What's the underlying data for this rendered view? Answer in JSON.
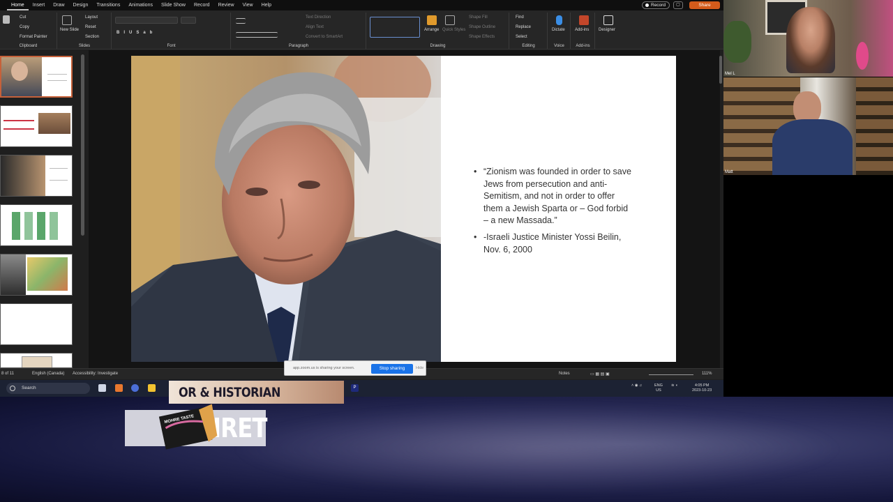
{
  "ppt": {
    "tabs": [
      "Home",
      "Insert",
      "Draw",
      "Design",
      "Transitions",
      "Animations",
      "Slide Show",
      "Record",
      "Review",
      "View",
      "Help"
    ],
    "record_label": "Record",
    "share_label": "Share",
    "comment_icon": "comment-icon",
    "ribbon": {
      "clipboard": {
        "cut": "Cut",
        "copy": "Copy",
        "format_painter": "Format Painter",
        "label": "Clipboard"
      },
      "slides": {
        "new_slide": "New Slide",
        "layout": "Layout",
        "reset": "Reset",
        "section": "Section",
        "label": "Slides"
      },
      "font": {
        "label": "Font"
      },
      "paragraph": {
        "text_direction": "Text Direction",
        "align_text": "Align Text",
        "convert_smartart": "Convert to SmartArt",
        "label": "Paragraph"
      },
      "drawing": {
        "arrange": "Arrange",
        "quick_styles": "Quick Styles",
        "shape_fill": "Shape Fill",
        "shape_outline": "Shape Outline",
        "shape_effects": "Shape Effects",
        "label": "Drawing"
      },
      "editing": {
        "find": "Find",
        "replace": "Replace",
        "select": "Select",
        "label": "Editing"
      },
      "voice": {
        "dictate": "Dictate",
        "label": "Voice"
      },
      "addins": {
        "addins": "Add-ins",
        "label": "Add-ins"
      },
      "designer": {
        "designer": "Designer"
      }
    },
    "slide": {
      "bullets": [
        "“Zionism was founded in order to save Jews from persecution and anti-Semitism, and not in order to offer them a Jewish Sparta or – God forbid  – a new Massada.”",
        "-Israeli Justice Minister Yossi Beilin, Nov. 6, 2000"
      ]
    },
    "status": {
      "slide_count": "8 of 11",
      "language": "English (Canada)",
      "accessibility": "Accessibility: Investigate",
      "notes": "Notes",
      "zoom": "111%"
    },
    "sharebar": {
      "message": "app.zoom.us is sharing your screen.",
      "stop": "Stop sharing",
      "hide": "Hide"
    }
  },
  "taskbar": {
    "search": "Search",
    "lang_top": "ENG",
    "lang_bottom": "US",
    "time": "4:05 PM",
    "date": "2023-10-23"
  },
  "video": {
    "top_name": "Mel L",
    "bottom_name": "Matt"
  },
  "overlay": {
    "title": "OR & HISTORIAN",
    "name": "IRET",
    "badge_text": "MOHRE TASTE"
  },
  "colors": {
    "accent_orange": "#d35b1b",
    "stop_blue": "#1a73e8",
    "selected_thumb": "#c6613a"
  }
}
